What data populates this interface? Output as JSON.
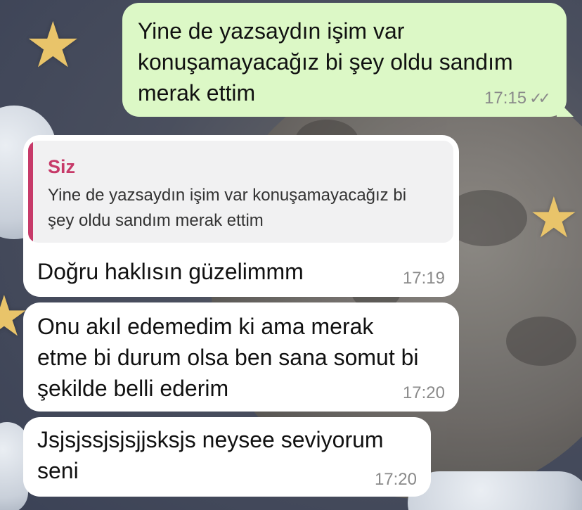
{
  "chat": {
    "messages": [
      {
        "direction": "outgoing",
        "text_lines": [
          "Yine de yazsaydın işim var",
          "konuşamayacağız bi şey oldu sandım",
          "merak ettim"
        ],
        "time": "17:15",
        "status": "read"
      },
      {
        "direction": "incoming",
        "reply_to": {
          "author": "Siz",
          "text_lines": [
            "Yine de yazsaydın işim var konuşamayacağız bi",
            "şey oldu sandım merak ettim"
          ]
        },
        "text": "Doğru haklısın güzelimmm",
        "time": "17:19"
      },
      {
        "direction": "incoming",
        "text_lines": [
          "Onu akıl edemedim ki ama merak",
          "etme bi durum olsa ben sana somut bi",
          "şekilde belli ederim"
        ],
        "time": "17:20"
      },
      {
        "direction": "incoming",
        "text_lines": [
          "Jsjsjssjsjsjjsksjs neysee seviyorum",
          "seni"
        ],
        "time": "17:20"
      }
    ]
  },
  "colors": {
    "outgoing_bubble": "#dcf8c6",
    "incoming_bubble": "#ffffff",
    "reply_accent": "#c73a69",
    "timestamp": "#8a8a8a"
  },
  "icons": {
    "read_receipt": "double-check-icon"
  }
}
